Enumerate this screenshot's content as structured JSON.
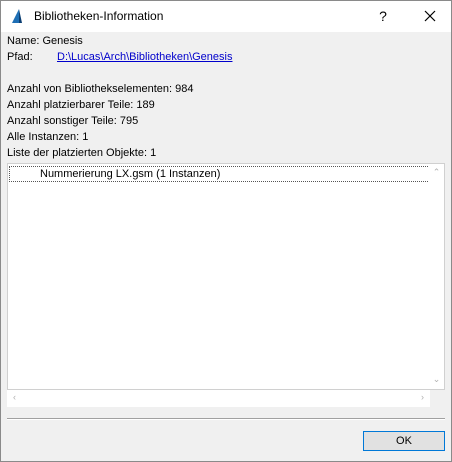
{
  "window": {
    "title": "Bibliotheken-Information",
    "help_label": "?"
  },
  "info": {
    "name": "Name: Genesis",
    "path_label": "Pfad:",
    "path_value": "D:\\Lucas\\Arch\\Bibliotheken\\Genesis",
    "library_elements": "Anzahl von Bibliothekselementen: 984",
    "placeable_parts": "Anzahl platzierbarer Teile: 189",
    "other_parts": "Anzahl sonstiger Teile: 795",
    "all_instances": "Alle Instanzen: 1",
    "placed_objects_header": "Liste der platzierten Objekte: 1"
  },
  "list": {
    "items": [
      {
        "label": "Nummerierung LX.gsm (1 Instanzen)"
      }
    ]
  },
  "buttons": {
    "ok": "OK"
  },
  "colors": {
    "link": "#0000cc",
    "focus_border": "#0078d7",
    "icon_blue": "#1f6fb5"
  }
}
